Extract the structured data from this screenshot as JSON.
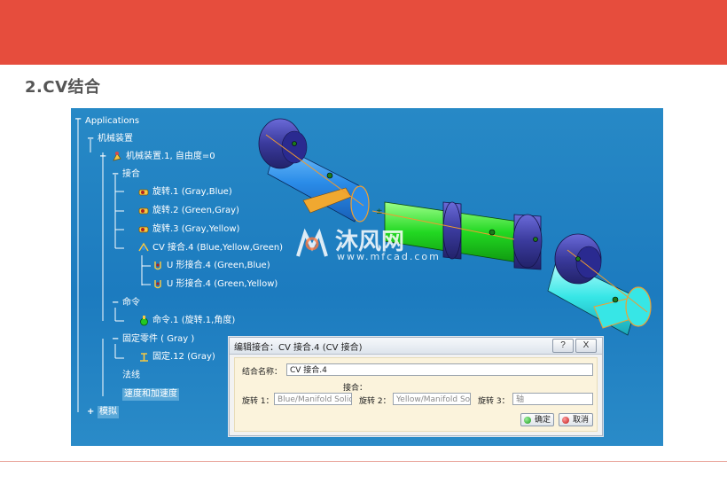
{
  "slide": {
    "title": "2.CV结合"
  },
  "watermark": {
    "brand": "沐风网",
    "url": "www.mfcad.com"
  },
  "tree": {
    "root": "Applications",
    "mechanism_group": "机械装置",
    "mechanism": "机械装置.1, 自由度=0",
    "joints_group": "接合",
    "joints": [
      "旋转.1 (Gray,Blue)",
      "旋转.2 (Green,Gray)",
      "旋转.3 (Gray,Yellow)",
      "CV 接合.4 (Blue,Yellow,Green)"
    ],
    "cv_children": [
      "U 形接合.4 (Green,Blue)",
      "U 形接合.4 (Green,Yellow)"
    ],
    "commands_group": "命令",
    "command": "命令.1 (旋转.1,角度)",
    "fixed_group": "固定零件 ( Gray )",
    "fixed": "固定.12 (Gray)",
    "laws": "法线",
    "speed_accel": "速度和加速度",
    "simulation": "模拟"
  },
  "dialog": {
    "title": "编辑接合：CV 接合.4 (CV 接合)",
    "help_label": "?",
    "close_label": "X",
    "name_label": "结合名称：",
    "name_value": "CV 接合.4",
    "joints_label": "接合：",
    "rot1_label": "旋转 1：",
    "rot1_value": "Blue/Manifold Solid",
    "rot2_label": "旋转 2：",
    "rot2_value": "Yellow/Manifold Soli",
    "rot3_label": "旋转 3：",
    "rot3_value": "轴",
    "ok_label": "确定",
    "cancel_label": "取消"
  },
  "colors": {
    "banner": "#e64d3d",
    "viewport": "#1f80c3",
    "part_blue": "#2a8ce8",
    "part_green": "#22d822",
    "part_cyan": "#37e6e6",
    "part_gray": "#3a3a9c"
  }
}
